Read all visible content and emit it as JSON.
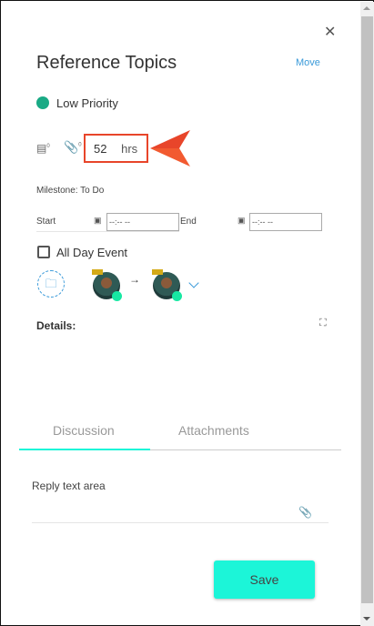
{
  "header": {
    "title": "Reference Topics",
    "move_label": "Move",
    "close_icon": "close-icon"
  },
  "priority": {
    "label": "Low Priority",
    "color": "#1aaa85"
  },
  "hours": {
    "value": "52",
    "unit": "hrs",
    "counters": {
      "notes": "0",
      "attachments": "0"
    }
  },
  "milestone": "Milestone: To Do",
  "dates": {
    "start_label": "Start",
    "start_value": "--:-- --",
    "end_label": "End",
    "end_value": "--:-- --"
  },
  "all_day": {
    "label": "All Day Event",
    "checked": false
  },
  "details_label": "Details:",
  "tabs": [
    {
      "label": "Discussion",
      "active": true
    },
    {
      "label": "Attachments",
      "active": false
    }
  ],
  "reply": {
    "placeholder": "Reply text area"
  },
  "save_label": "Save",
  "colors": {
    "accent": "#1cf5d8",
    "link": "#3a9ad9",
    "highlight": "#e8452a"
  }
}
